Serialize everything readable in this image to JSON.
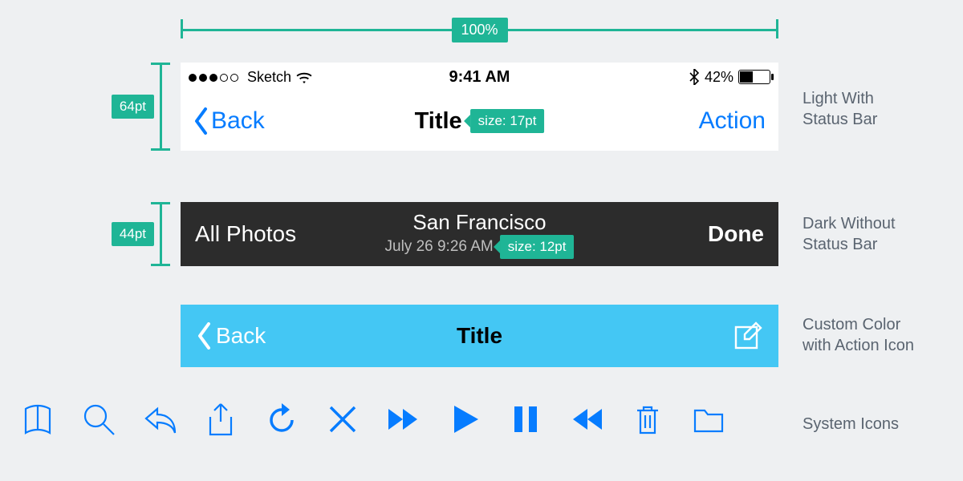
{
  "ruler": {
    "width_label": "100%"
  },
  "measures": {
    "light_height": "64pt",
    "dark_height": "44pt"
  },
  "captions": {
    "light": "Light With\nStatus Bar",
    "dark": "Dark Without\nStatus Bar",
    "cyan": "Custom Color\nwith Action Icon",
    "icons": "System Icons"
  },
  "status_bar": {
    "carrier": "Sketch",
    "time": "9:41 AM",
    "battery_pct": "42%"
  },
  "light_nav": {
    "back_label": "Back",
    "title": "Title",
    "title_size_badge": "size: 17pt",
    "action_label": "Action"
  },
  "dark_nav": {
    "left_label": "All Photos",
    "title": "San Francisco",
    "subtitle": "July 26 9:26 AM",
    "subtitle_size_badge": "size: 12pt",
    "right_label": "Done"
  },
  "cyan_nav": {
    "back_label": "Back",
    "title": "Title"
  },
  "colors": {
    "teal": "#1fb596",
    "ios_blue": "#067cff",
    "cyan": "#44c7f4",
    "dark": "#2c2c2c"
  }
}
